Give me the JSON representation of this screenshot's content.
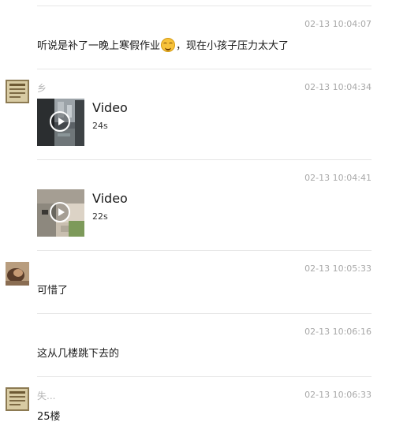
{
  "messages": [
    {
      "time": "02-13 10:04:07",
      "text_before_emoji": "听说是补了一晚上寒假作业",
      "emoji": "grin-sweat-emoji",
      "text_after_emoji": "，现在小孩子压力太大了"
    },
    {
      "sender": "乡",
      "time": "02-13 10:04:34",
      "video_label": "Video",
      "duration": "24s"
    },
    {
      "time": "02-13 10:04:41",
      "video_label": "Video",
      "duration": "22s"
    },
    {
      "time": "02-13 10:05:33",
      "text": "可惜了"
    },
    {
      "time": "02-13 10:06:16",
      "text": "这从几楼跳下去的"
    },
    {
      "sender": "失...",
      "time": "02-13 10:06:33",
      "text": "25楼"
    }
  ]
}
